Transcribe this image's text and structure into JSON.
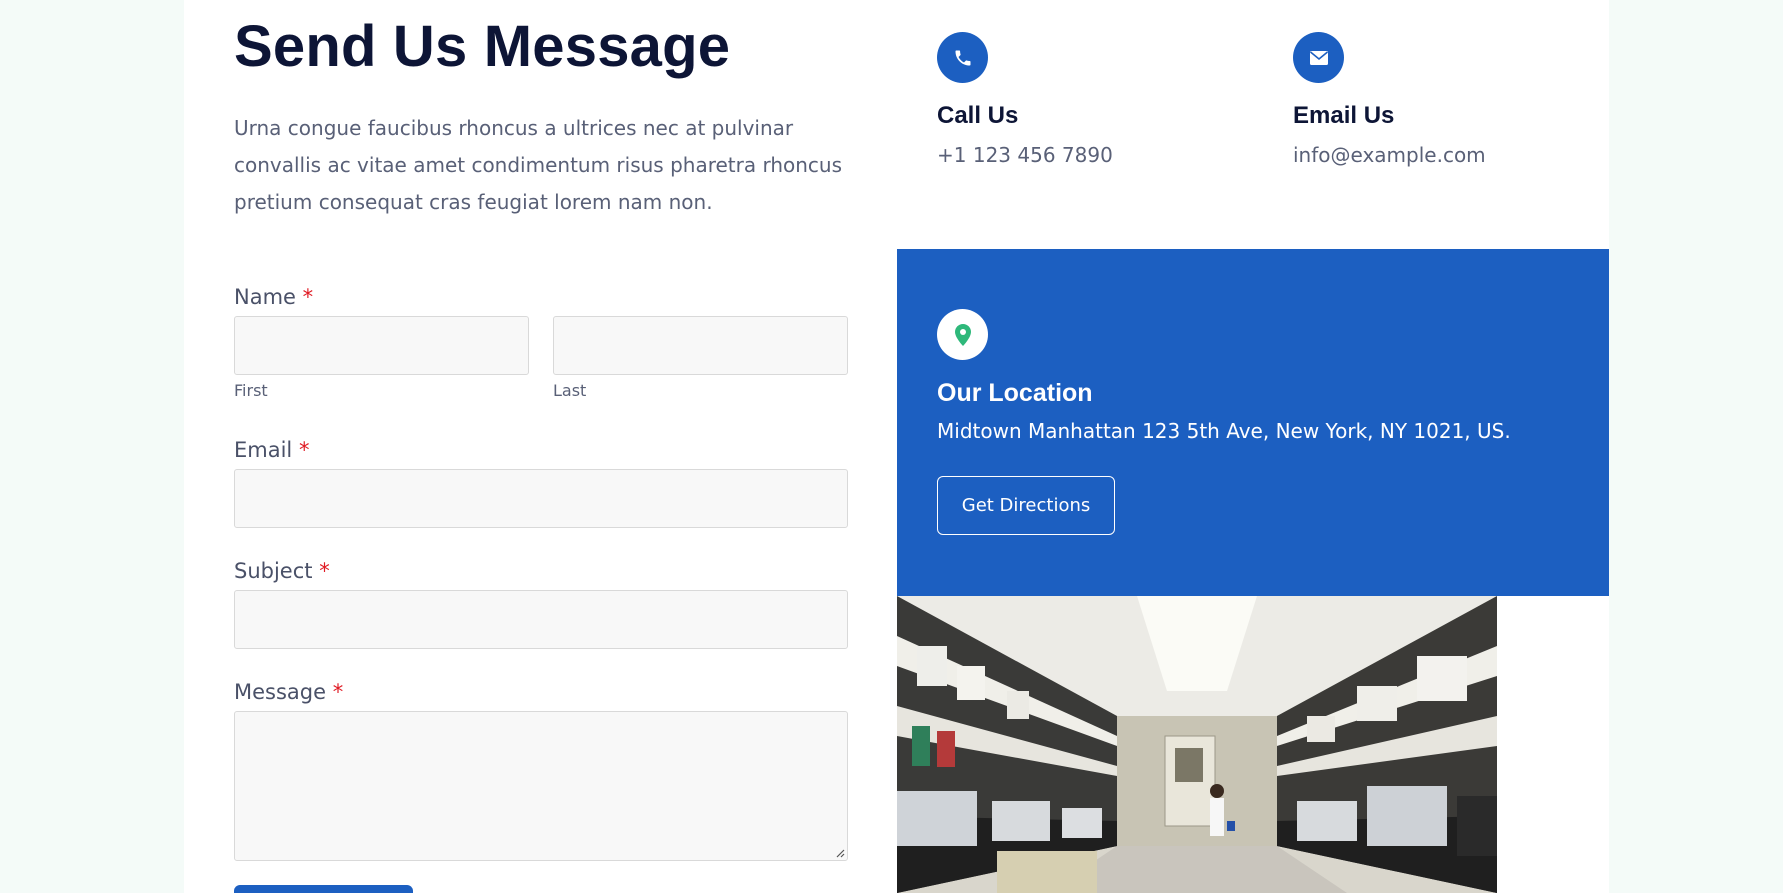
{
  "form": {
    "title": "Send Us Message",
    "intro": "Urna congue faucibus rhoncus a ultrices nec at pulvinar convallis ac vitae amet condimentum risus pharetra rhoncus pretium consequat cras feugiat lorem nam non.",
    "required_mark": "*",
    "name_label": "Name",
    "first_sublabel": "First",
    "last_sublabel": "Last",
    "email_label": "Email",
    "subject_label": "Subject",
    "message_label": "Message"
  },
  "contact": {
    "call_title": "Call Us",
    "call_value": "+1 123 456 7890",
    "email_title": "Email Us",
    "email_value": "info@example.com"
  },
  "location": {
    "title": "Our Location",
    "address": "Midtown Manhattan 123 5th Ave, New York, NY 1021, US.",
    "button_label": "Get Directions"
  },
  "icons": {
    "phone": "phone-icon",
    "email": "envelope-icon",
    "location": "map-pin-icon"
  },
  "colors": {
    "accent": "#1c5fc1",
    "heading": "#0d1536",
    "body_text": "#596077",
    "required": "#e01b24",
    "pin": "#2eb87a"
  }
}
